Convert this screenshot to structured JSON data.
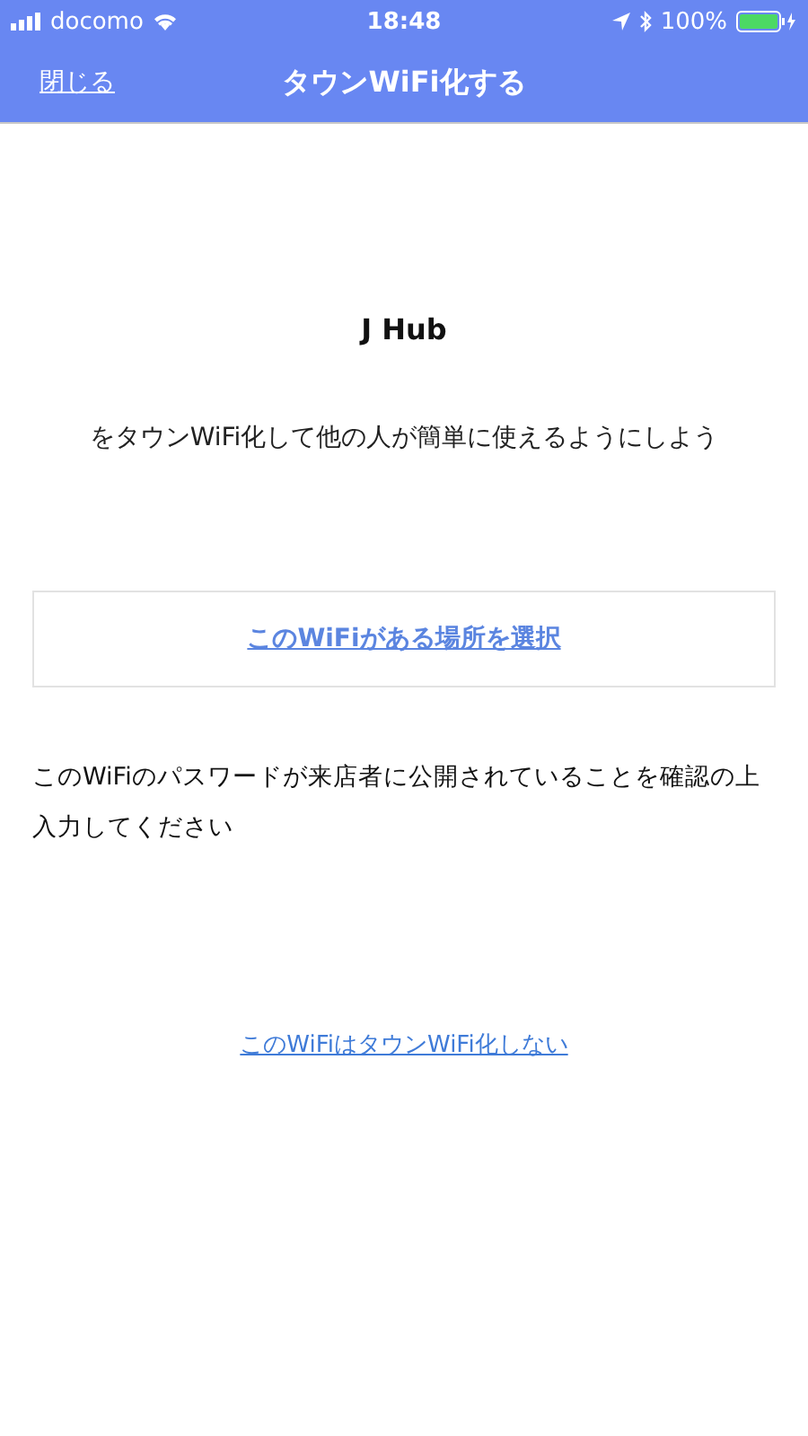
{
  "status_bar": {
    "carrier": "docomo",
    "time": "18:48",
    "battery": "100%"
  },
  "nav": {
    "close": "閉じる",
    "title": "タウンWiFi化する"
  },
  "network_name": "J Hub",
  "intro": "をタウンWiFi化して他の人が簡単に使えるようにしよう",
  "select_location": "このWiFiがある場所を選択",
  "notice": "このWiFiのパスワードが来店者に公開されていることを確認の上入力してください",
  "decline": "このWiFiはタウンWiFi化しない"
}
